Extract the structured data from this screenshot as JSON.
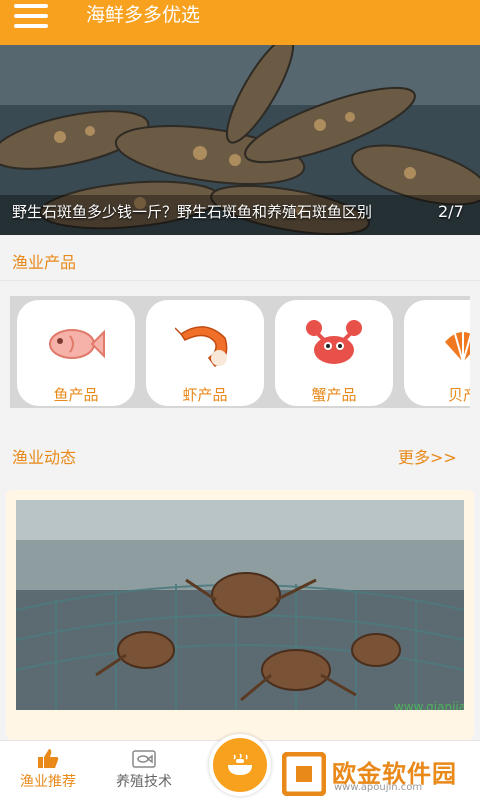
{
  "app": {
    "title": "海鲜多多优选"
  },
  "banner": {
    "caption": "野生石斑鱼多少钱一斤？野生石斑鱼和养殖石斑鱼区别",
    "counter": "2/7"
  },
  "products": {
    "title": "渔业产品",
    "items": [
      {
        "label": "鱼产品",
        "icon": "fish-icon"
      },
      {
        "label": "虾产品",
        "icon": "shrimp-icon"
      },
      {
        "label": "蟹产品",
        "icon": "crab-icon"
      },
      {
        "label": "贝产",
        "icon": "shell-icon"
      }
    ]
  },
  "news": {
    "title": "渔业动态",
    "more": "更多>>",
    "watermark": "www.qianjia.com"
  },
  "tabbar": {
    "tabs": [
      {
        "label": "渔业推荐",
        "icon": "thumbs-up-icon"
      },
      {
        "label": "养殖技术",
        "icon": "fish-tank-icon"
      }
    ]
  },
  "watermark_logo": {
    "text": "欧金软件园",
    "sub": "www.apoujin.com"
  },
  "colors": {
    "accent": "#f7a11e",
    "text_accent": "#e8891a"
  }
}
